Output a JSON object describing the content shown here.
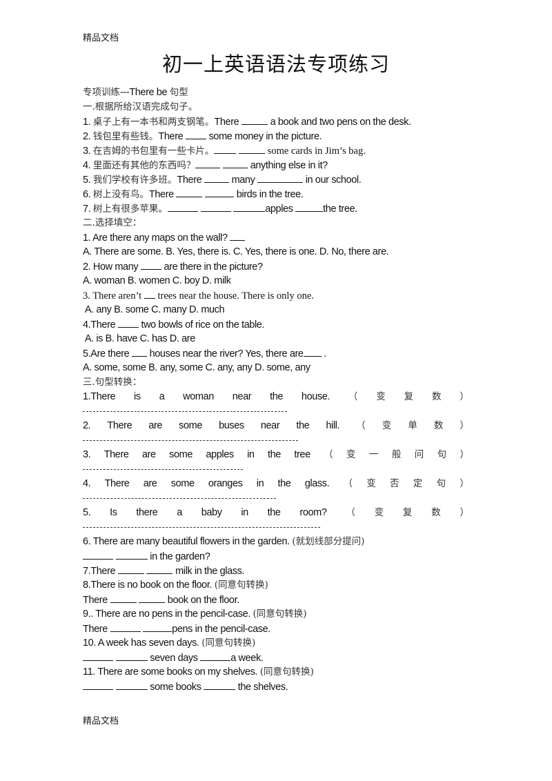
{
  "header": "精品文档",
  "footer": "精品文档",
  "title": "初一上英语语法专项练习",
  "subtitle": {
    "cn": "专项训练",
    "en": "---There be ",
    "cn2": "句型"
  },
  "section1": {
    "heading": "一.根据所给汉语完成句子。",
    "items": [
      {
        "num": "1. ",
        "cn": "桌子上有一本书和两支钢笔。",
        "parts": [
          "There ",
          " a book and two pens on the desk."
        ]
      },
      {
        "num": "2. ",
        "cn": "钱包里有些钱。",
        "parts": [
          "There ",
          " some money in the picture."
        ]
      },
      {
        "num": "3. ",
        "cn": "在吉姆的书包里有一些卡片。",
        "parts": [
          "",
          " ",
          " some cards in Jim’s bag."
        ]
      },
      {
        "num": "4. ",
        "cn": "里面还有其他的东西吗？",
        "parts": [
          "",
          " ",
          " anything else in it?"
        ]
      },
      {
        "num": "5. ",
        "cn": "我们学校有许多班。",
        "parts": [
          "There ",
          " many ",
          " in our school."
        ]
      },
      {
        "num": "6. ",
        "cn": "树上没有鸟。",
        "parts": [
          "There ",
          " ",
          " birds in the tree."
        ]
      },
      {
        "num": "7. ",
        "cn": "树上有很多苹果。",
        "parts": [
          "",
          " ",
          " ",
          "apples ",
          "the tree."
        ]
      }
    ]
  },
  "section2": {
    "heading": "二.选择填空：",
    "questions": [
      {
        "q": "1. Are there any maps on the wall? ",
        "options": "A. There are some. B. Yes, there is. C. Yes, there is one. D. No, there are."
      },
      {
        "q_pre": "2. How many ",
        "q_post": " are there in the picture?",
        "options": "A. woman B. women C. boy D. milk"
      },
      {
        "q_pre": "3. There aren’t ",
        "q_post": " trees near the house. There is only one.",
        "options": " A. any B. some C. many D. much"
      },
      {
        "q_pre": "4.There ",
        "q_post": " two bowls of rice on the table.",
        "options": " A. is B. have C. has D. are"
      },
      {
        "q_pre": "5.Are there ",
        "q_mid": " houses near the river? Yes, there are",
        "q_post": " .",
        "options": "A. some, some B. any, some C. any, any D. some, any"
      }
    ]
  },
  "section3": {
    "heading": "三.句型转换：",
    "justified": [
      {
        "words": [
          "1.There",
          "is",
          "a",
          "woman",
          "near",
          "the",
          "house."
        ],
        "note": [
          "（",
          "变",
          "复",
          "数",
          "）"
        ]
      },
      {
        "words": [
          "2.",
          "There",
          "are",
          "some",
          "buses",
          "near",
          "the",
          "hill."
        ],
        "note": [
          "（",
          "变",
          "单",
          "数",
          "）"
        ]
      },
      {
        "words": [
          "3.",
          "There",
          "are",
          "some",
          "apples",
          "in",
          "the",
          "tree"
        ],
        "note": [
          "（",
          "变",
          "一",
          "般",
          "问",
          "句",
          "）"
        ]
      },
      {
        "words": [
          "4.",
          "There",
          "are",
          "some",
          "oranges",
          "in",
          "the",
          "glass."
        ],
        "note": [
          "（",
          "变",
          "否",
          "定",
          "句",
          "）"
        ]
      },
      {
        "words": [
          "5.",
          "Is",
          "there",
          "a",
          "baby",
          "in",
          "the",
          "room?"
        ],
        "note": [
          "（",
          "变",
          "复",
          "数",
          "）"
        ]
      }
    ],
    "q6": {
      "text": "6. There are many beautiful flowers in the garden. ",
      "note": "(就划线部分提问)",
      "answer_post": " in the garden?"
    },
    "q7": {
      "pre": "7.There ",
      "post": " milk in the glass."
    },
    "q8": {
      "text": "8.There is no book on the floor. ",
      "note": "(同意句转换)",
      "answer_pre": "There ",
      "answer_post": " book on the floor."
    },
    "q9": {
      "text": "9.. There are no pens in the pencil-case. ",
      "note": "(同意句转换)",
      "answer_pre": "There ",
      "answer_post": "pens in the pencil-case."
    },
    "q10": {
      "text": "10. A week has seven days. ",
      "note": "(同意句转换)",
      "answer_mid": " seven days ",
      "answer_post": "a week."
    },
    "q11": {
      "text": "11. There are some books on my shelves. ",
      "note": "(同意句转换)",
      "answer_mid": " some books ",
      "answer_post": " the shelves."
    }
  }
}
